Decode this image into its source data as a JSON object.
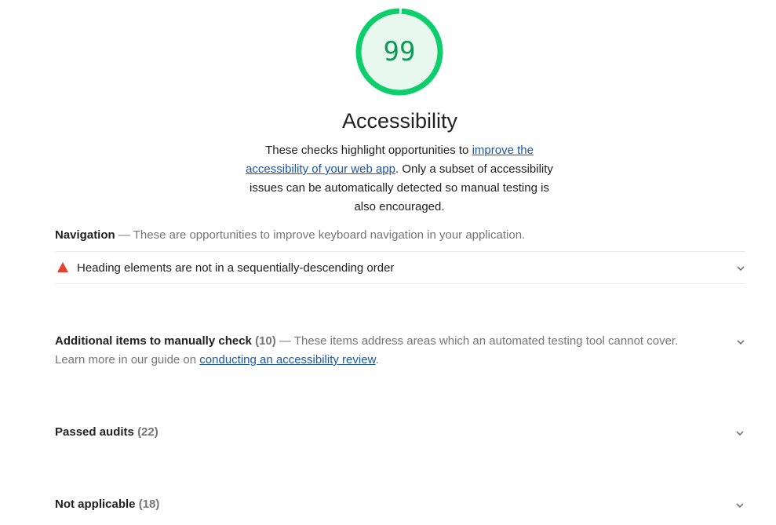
{
  "score": {
    "value": "99",
    "fraction": 0.99,
    "color": "#0cce6b",
    "text_color": "#0c9b54",
    "fill_color": "#e8f8ef"
  },
  "category": {
    "title": "Accessibility",
    "description_prefix": "These checks highlight opportunities to ",
    "description_link": "improve the accessibility of your web app",
    "description_suffix": ". Only a subset of accessibility issues can be automatically detected so manual testing is also encouraged."
  },
  "navigation_group": {
    "title": "Navigation",
    "description": " — These are opportunities to improve keyboard navigation in your application."
  },
  "audits": [
    {
      "title": "Heading elements are not in a sequentially-descending order",
      "status_icon": "fail-triangle-icon",
      "status_color": "#e8412c"
    }
  ],
  "manual_group": {
    "title": "Additional items to manually check",
    "count": "(10)",
    "description": " — These items address areas which an automated testing tool cannot cover.",
    "learn_prefix": "Learn more in our guide on ",
    "learn_link": "conducting an accessibility review",
    "learn_suffix": "."
  },
  "passed_group": {
    "title": "Passed audits",
    "count": "(22)"
  },
  "not_applicable_group": {
    "title": "Not applicable",
    "count": "(18)"
  },
  "icons": {
    "expand": "chevron-down-icon"
  }
}
